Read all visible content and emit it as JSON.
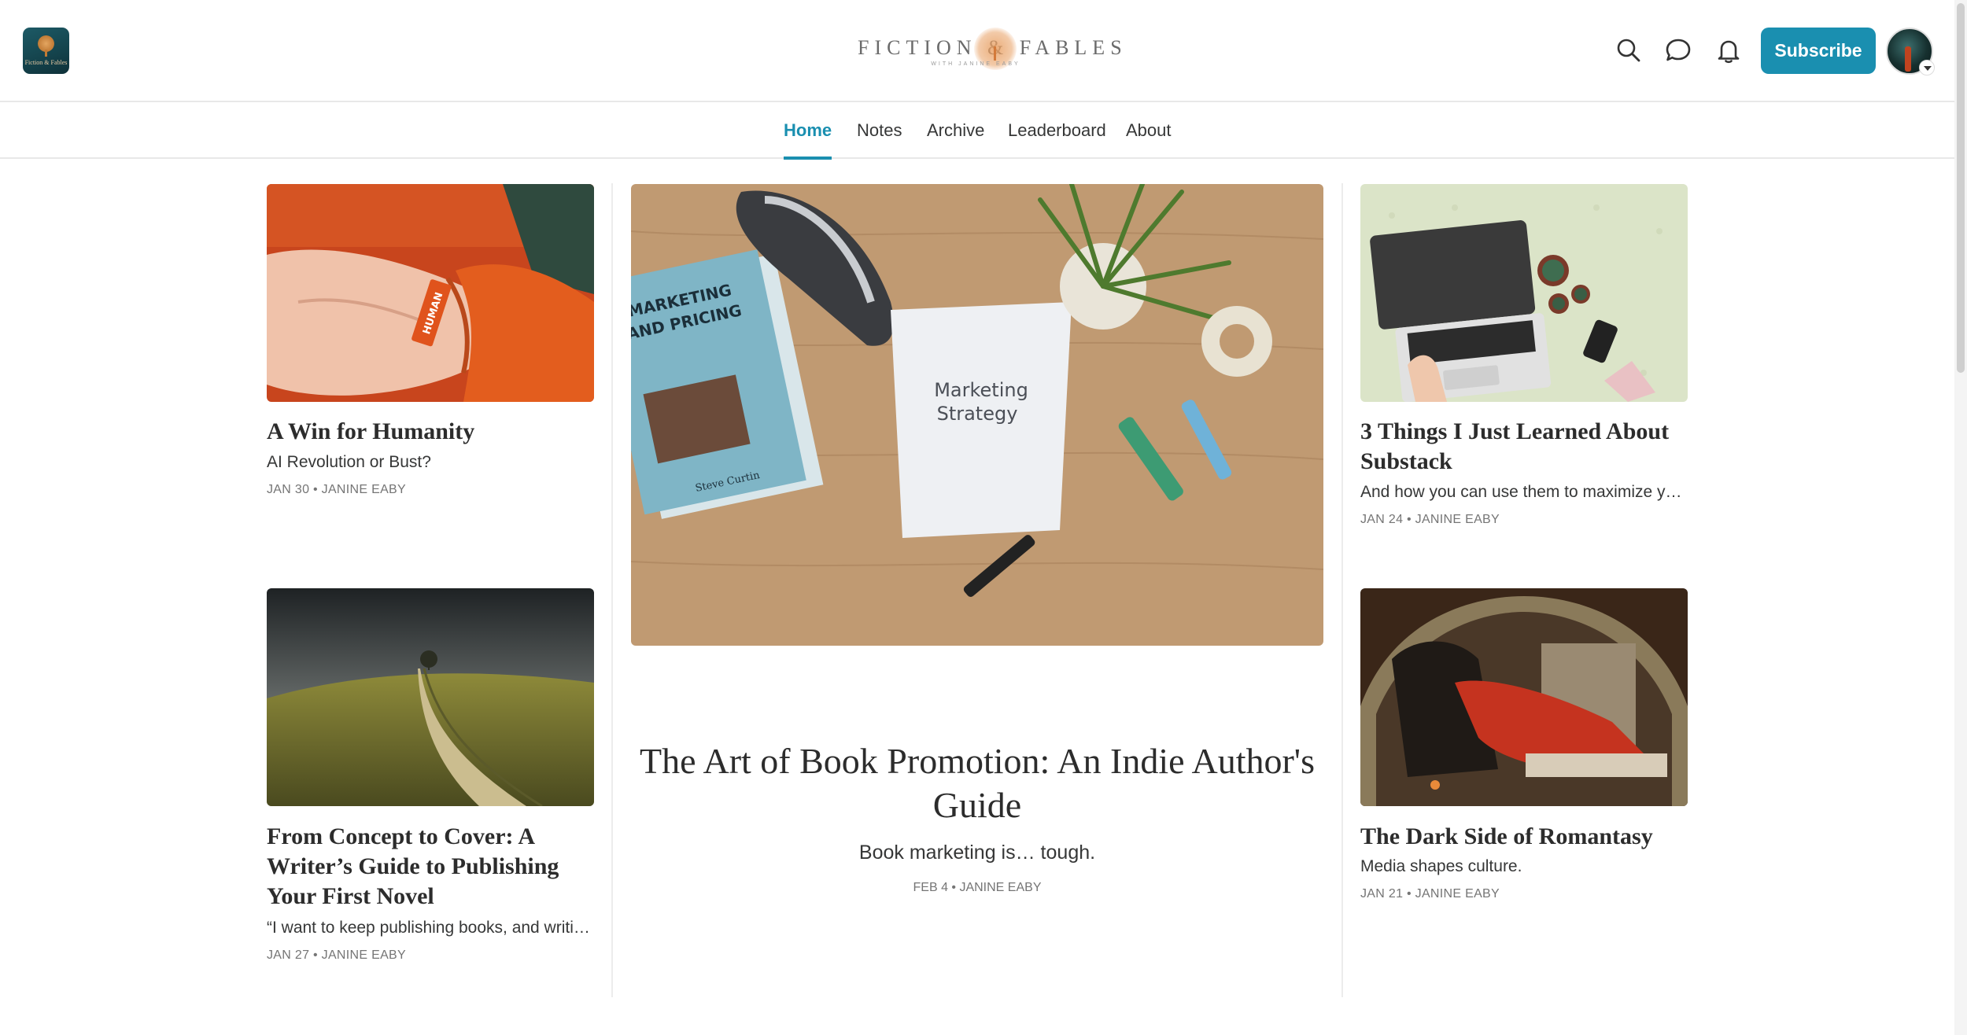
{
  "header": {
    "logo_tiny_text": "Fiction & Fables",
    "wordmark": "FICTION & FABLES",
    "wordmark_byline": "WITH JANINE EABY",
    "subscribe_label": "Subscribe",
    "icons": [
      "search-icon",
      "chat-icon",
      "bell-icon"
    ]
  },
  "nav": {
    "tabs": [
      {
        "label": "Home",
        "active": true
      },
      {
        "label": "Notes",
        "active": false
      },
      {
        "label": "Archive",
        "active": false
      },
      {
        "label": "Leaderboard",
        "active": false
      },
      {
        "label": "About",
        "active": false
      }
    ]
  },
  "featured": {
    "title": "The Art of Book Promotion: An Indie Author's Guide",
    "subtitle": "Book marketing is… tough.",
    "meta": "FEB 4 • JANINE EABY",
    "image_text": {
      "note": "Marketing Strategy",
      "book": "THE DESIGNER'S GUIDE TO MARKETING AND PRICING",
      "book_author": "Steve Curtin"
    }
  },
  "posts": [
    {
      "title": "A Win for Humanity",
      "subtitle": "AI Revolution or Bust?",
      "meta": "JAN 30 • JANINE EABY",
      "image_text": "HUMAN"
    },
    {
      "title": "3 Things I Just Learned About Substack",
      "subtitle": "And how you can use them to maximize yo…",
      "meta": "JAN 24 • JANINE EABY"
    },
    {
      "title": "From Concept to Cover: A Writer’s Guide to Publishing Your First Novel",
      "subtitle": "“I want to keep publishing books, and writin…",
      "meta": "JAN 27 • JANINE EABY"
    },
    {
      "title": "The Dark Side of Romantasy",
      "subtitle": "Media shapes culture.",
      "meta": "JAN 21 • JANINE EABY"
    }
  ],
  "colors": {
    "accent": "#1a8fb0",
    "text": "#363737",
    "meta": "#757575",
    "divider": "#e8e8e8"
  }
}
